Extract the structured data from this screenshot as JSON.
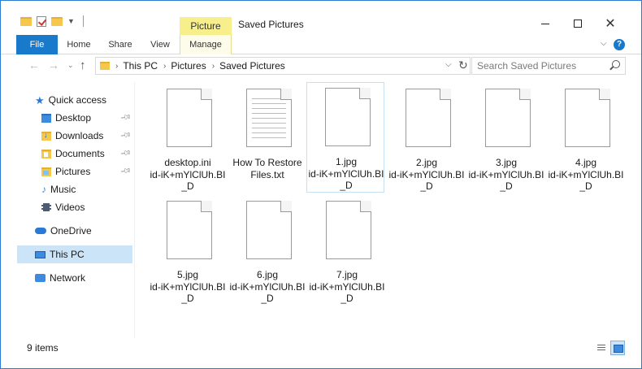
{
  "window": {
    "title": "Saved Pictures",
    "contextual_group": "Picture Tools"
  },
  "ribbon": {
    "tabs": [
      "File",
      "Home",
      "Share",
      "View",
      "Manage"
    ]
  },
  "address": {
    "crumbs": [
      "This PC",
      "Pictures",
      "Saved Pictures"
    ]
  },
  "search": {
    "placeholder": "Search Saved Pictures"
  },
  "sidebar": {
    "items": [
      {
        "label": "Quick access",
        "icon": "star-icon"
      },
      {
        "label": "Desktop",
        "icon": "desktop-folder-icon",
        "pinned": true
      },
      {
        "label": "Downloads",
        "icon": "downloads-folder-icon",
        "pinned": true
      },
      {
        "label": "Documents",
        "icon": "documents-folder-icon",
        "pinned": true
      },
      {
        "label": "Pictures",
        "icon": "pictures-folder-icon",
        "pinned": true
      },
      {
        "label": "Music",
        "icon": "music-icon"
      },
      {
        "label": "Videos",
        "icon": "videos-icon"
      },
      {
        "label": "OneDrive",
        "icon": "cloud-icon"
      },
      {
        "label": "This PC",
        "icon": "computer-icon",
        "selected": true
      },
      {
        "label": "Network",
        "icon": "network-icon"
      }
    ]
  },
  "files": [
    {
      "name": "desktop.ini\nid-iK+mYlClUh.BI\n_D",
      "type": "file"
    },
    {
      "name": "How To Restore\nFiles.txt",
      "type": "text"
    },
    {
      "name": "1.jpg\nid-iK+mYlClUh.BI\n_D",
      "type": "file",
      "selected": true
    },
    {
      "name": "2.jpg\nid-iK+mYlClUh.BI\n_D",
      "type": "file"
    },
    {
      "name": "3.jpg\nid-iK+mYlClUh.BI\n_D",
      "type": "file"
    },
    {
      "name": "4.jpg\nid-iK+mYlClUh.BI\n_D",
      "type": "file"
    },
    {
      "name": "5.jpg\nid-iK+mYlClUh.BI\n_D",
      "type": "file"
    },
    {
      "name": "6.jpg\nid-iK+mYlClUh.BI\n_D",
      "type": "file"
    },
    {
      "name": "7.jpg\nid-iK+mYlClUh.BI\n_D",
      "type": "file"
    }
  ],
  "status": {
    "item_count": "9 items"
  },
  "colors": {
    "accent": "#1979ca",
    "selection": "#cce4f7",
    "contextual": "#f7ef8c"
  }
}
